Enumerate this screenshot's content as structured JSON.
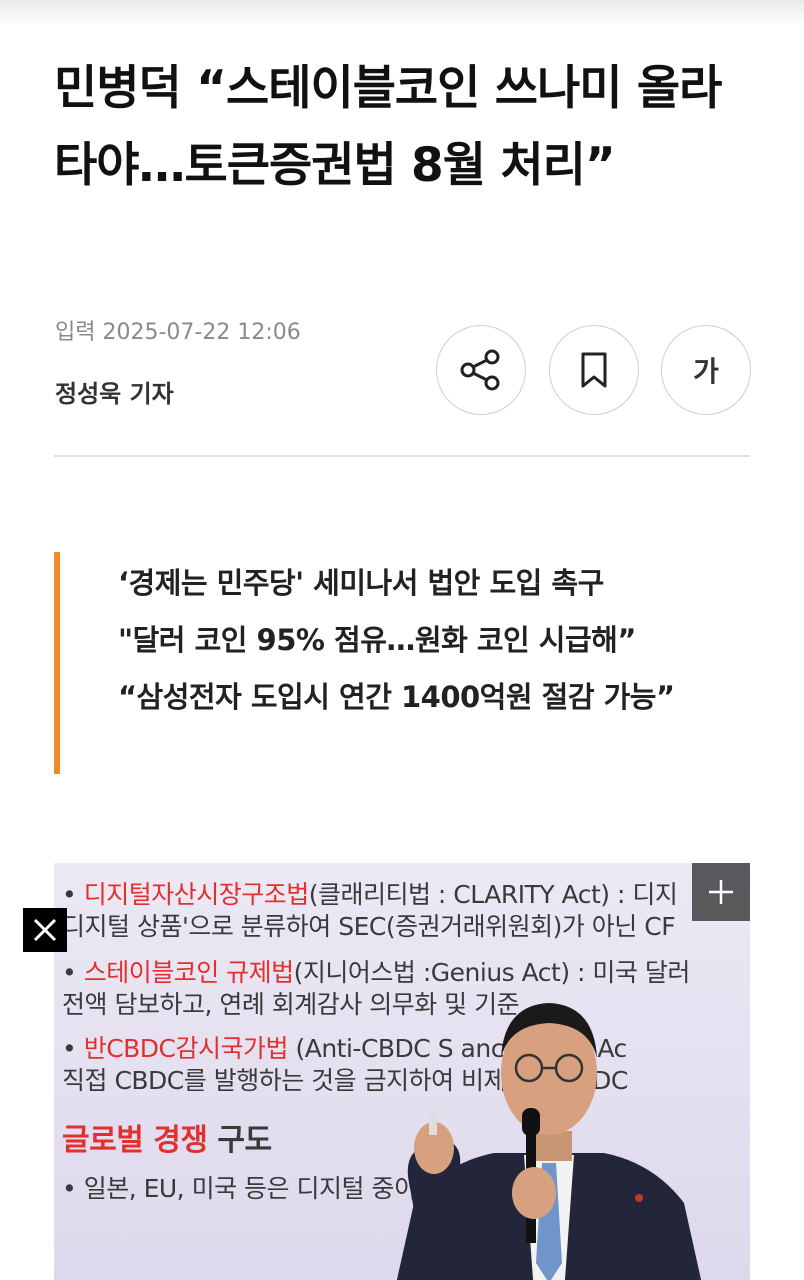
{
  "article": {
    "headline": "민병덕 “스테이블코인 쓰나미 올라타야…토큰증권법 8월 처리”",
    "date": "입력 2025-07-22 12:06",
    "author": "정성욱 기자"
  },
  "toolbar": {
    "share_icon": "share-icon",
    "bookmark_icon": "bookmark-icon",
    "font_label": "가"
  },
  "summary": {
    "lines": [
      "‘경제는 민주당' 세미나서 법안 도입 촉구",
      "\"달러 코인 95% 점유…원화 코인 시급해”",
      "“삼성전자 도입시 연간 1400억원 절감 가능”"
    ]
  },
  "photo": {
    "slide": {
      "l1_red": "디지털자산시장구조법",
      "l1_rest": "(클래리티법 : CLARITY Act) : 디지",
      "l2": "디지털 상품'으로 분류하여 SEC(증권거래위원회)가 아닌 CF",
      "l3_red": "스테이블코인 규제법",
      "l3_rest": "(지니어스법 :Genius Act) : 미국 달러",
      "l4": "전액 담보하고, 연례 회계감사 의무화 및      기준",
      "l5_red": "반CBDC감시국가법",
      "l5_rest": " (Anti-CBDC S        ance State Ac",
      "l6": "직접 CBDC를 발행하는 것을 금지하여      비제도의 CBDC",
      "l7_red": "글로벌 경쟁",
      "l7_rest": " 구도",
      "l8": "• 일본, EU, 미국 등은 디지털                    중이며"
    }
  },
  "colors": {
    "accent": "#f08a2a",
    "slide_red": "#e2302e"
  }
}
